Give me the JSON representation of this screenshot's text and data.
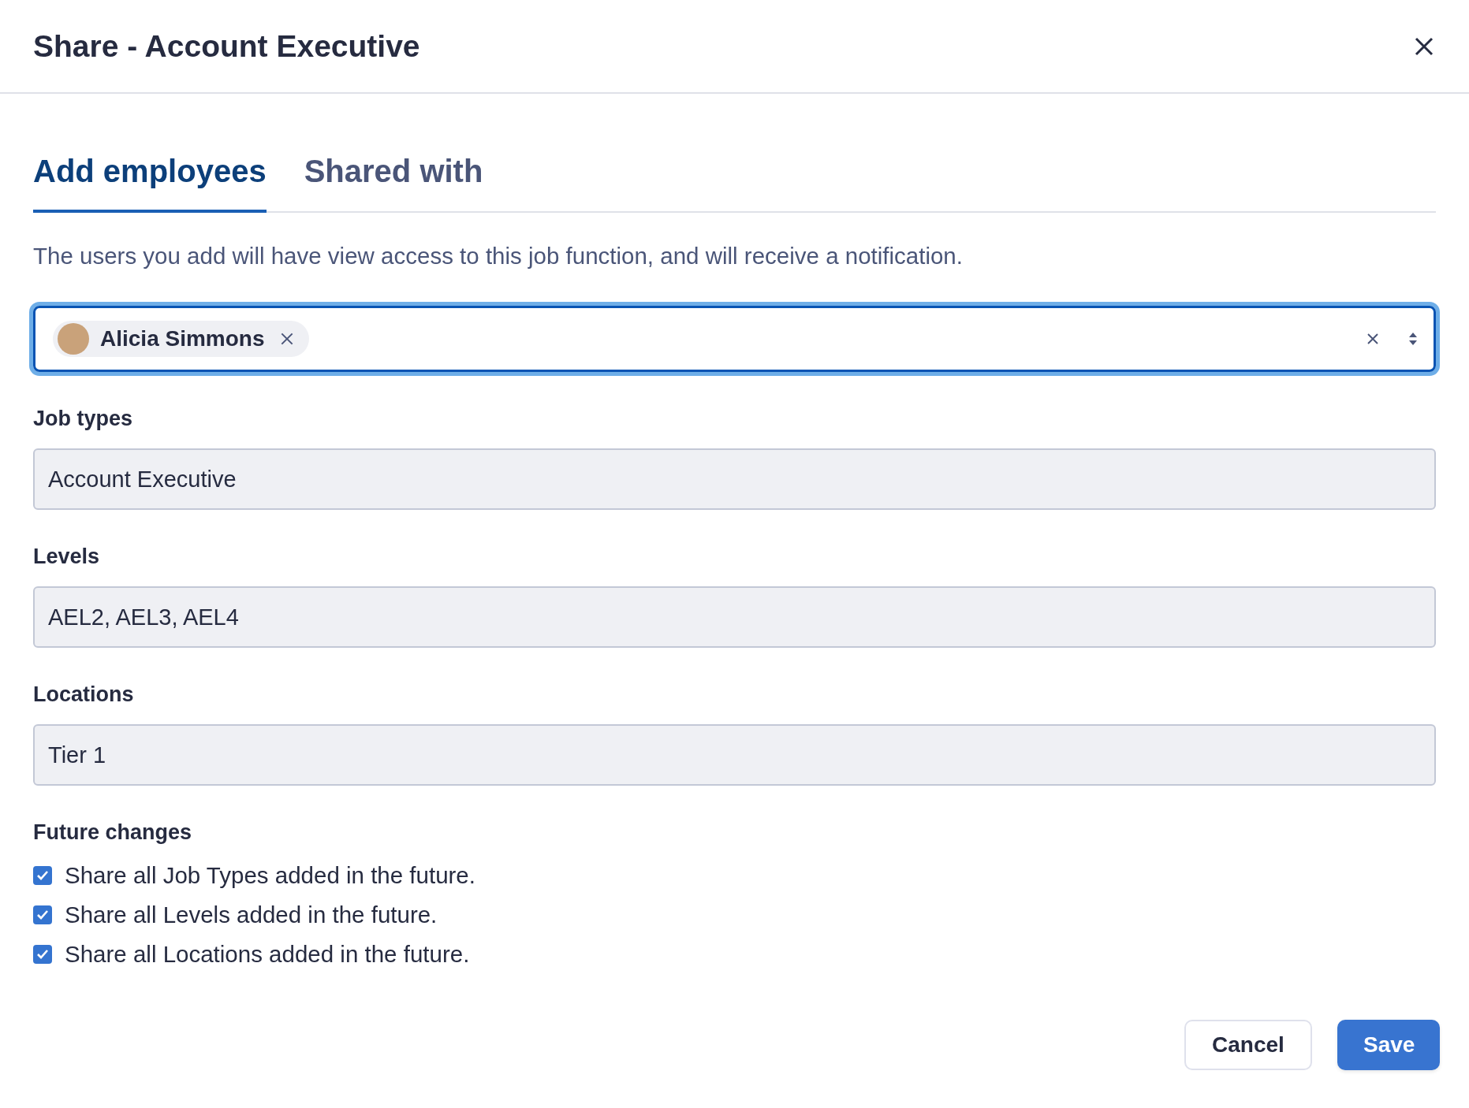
{
  "dialog": {
    "title": "Share - Account Executive"
  },
  "tabs": [
    {
      "label": "Add employees",
      "selected": true
    },
    {
      "label": "Shared with",
      "selected": false
    }
  ],
  "description": "The users you add will have view access to this job function, and will receive a notification.",
  "employee_select": {
    "focused": true,
    "chips": [
      {
        "name": "Alicia Simmons"
      }
    ]
  },
  "fields": [
    {
      "label": "Job types",
      "value": "Account Executive"
    },
    {
      "label": "Levels",
      "value": "AEL2, AEL3, AEL4"
    },
    {
      "label": "Locations",
      "value": "Tier 1"
    }
  ],
  "future_changes": {
    "label": "Future changes",
    "options": [
      {
        "label": "Share all Job Types added in the future.",
        "checked": true
      },
      {
        "label": "Share all Levels added in the future.",
        "checked": true
      },
      {
        "label": "Share all Locations added in the future.",
        "checked": true
      }
    ]
  },
  "buttons": [
    {
      "label": "Cancel",
      "kind": "secondary"
    },
    {
      "label": "Save",
      "kind": "primary"
    }
  ]
}
